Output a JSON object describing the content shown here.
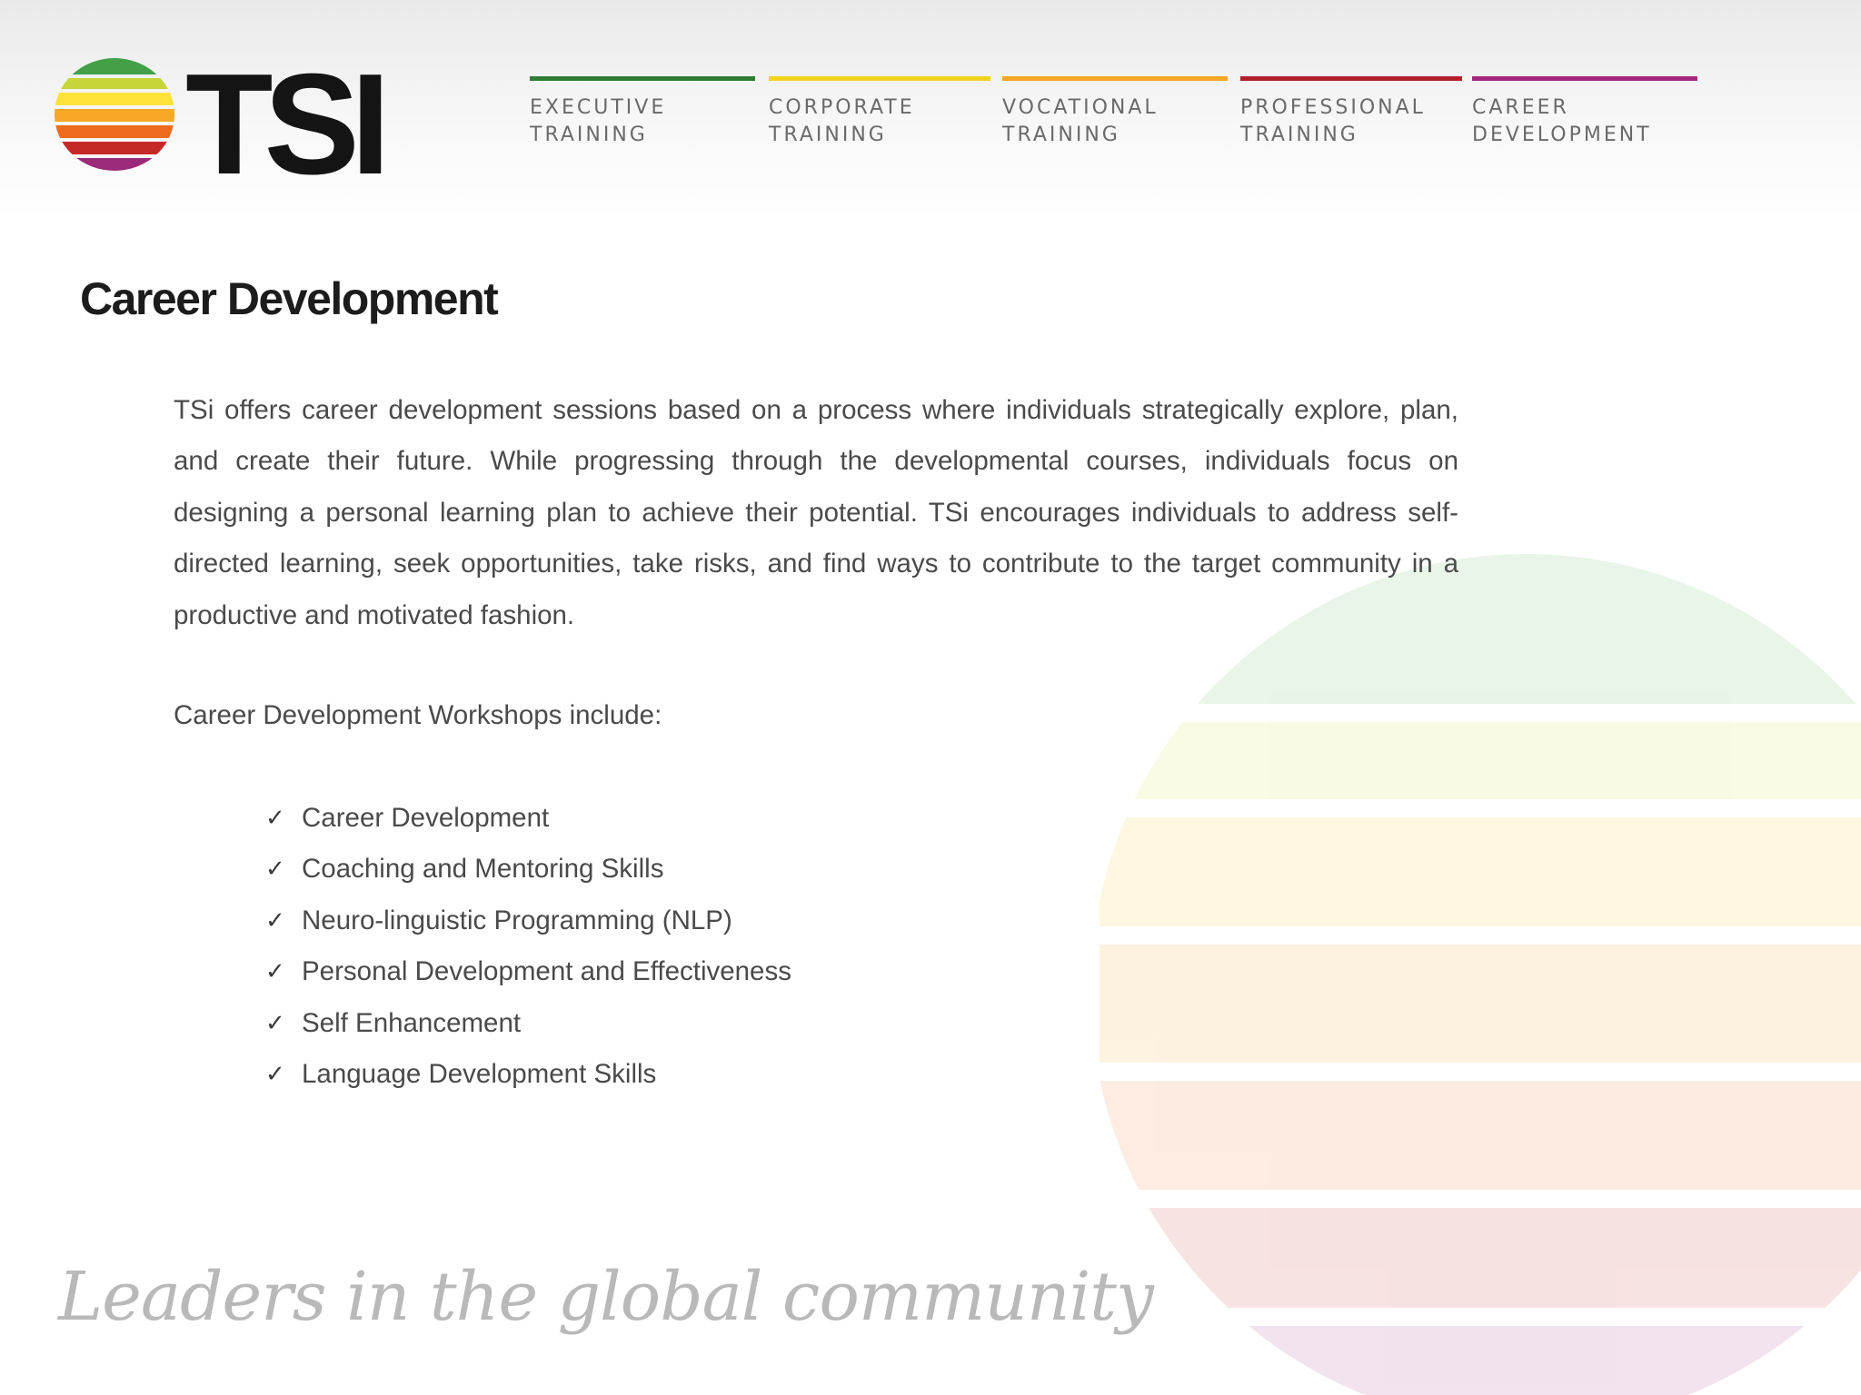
{
  "brand": {
    "logo_text": "TSI",
    "tagline": "Leaders in the global community"
  },
  "nav": {
    "items": [
      {
        "label": "EXECUTIVE\nTRAINING",
        "color": "#2e7d32"
      },
      {
        "label": "CORPORATE\nTRAINING",
        "color": "#f2d21c"
      },
      {
        "label": "VOCATIONAL\nTRAINING",
        "color": "#f5a623"
      },
      {
        "label": "PROFESSIONAL\nTRAINING",
        "color": "#b0202a"
      },
      {
        "label": "CAREER\nDEVELOPMENT",
        "color": "#a3287d"
      }
    ]
  },
  "content": {
    "title": "Career Development",
    "intro": "TSi offers career development sessions based on a process where individuals strategically explore, plan, and create their future. While progressing through the developmental courses, individuals focus on designing a personal learning plan to achieve their potential. TSi encourages individuals to address self-directed learning, seek opportunities, take risks, and find ways to contribute to the target community in a productive and motivated fashion.",
    "workshops_heading": "Career Development Workshops include:",
    "check_glyph": "✓",
    "workshops": [
      "Career Development",
      "Coaching and Mentoring Skills",
      "Neuro-linguistic Programming (NLP)",
      "Personal Development and Effectiveness",
      "Self Enhancement",
      "Language Development Skills"
    ]
  },
  "colors": {
    "globe_green": "#4caf50",
    "globe_yellow": "#fde23a",
    "globe_orange": "#f7a21b",
    "globe_red": "#c62828",
    "globe_purple": "#9c2a7a"
  }
}
